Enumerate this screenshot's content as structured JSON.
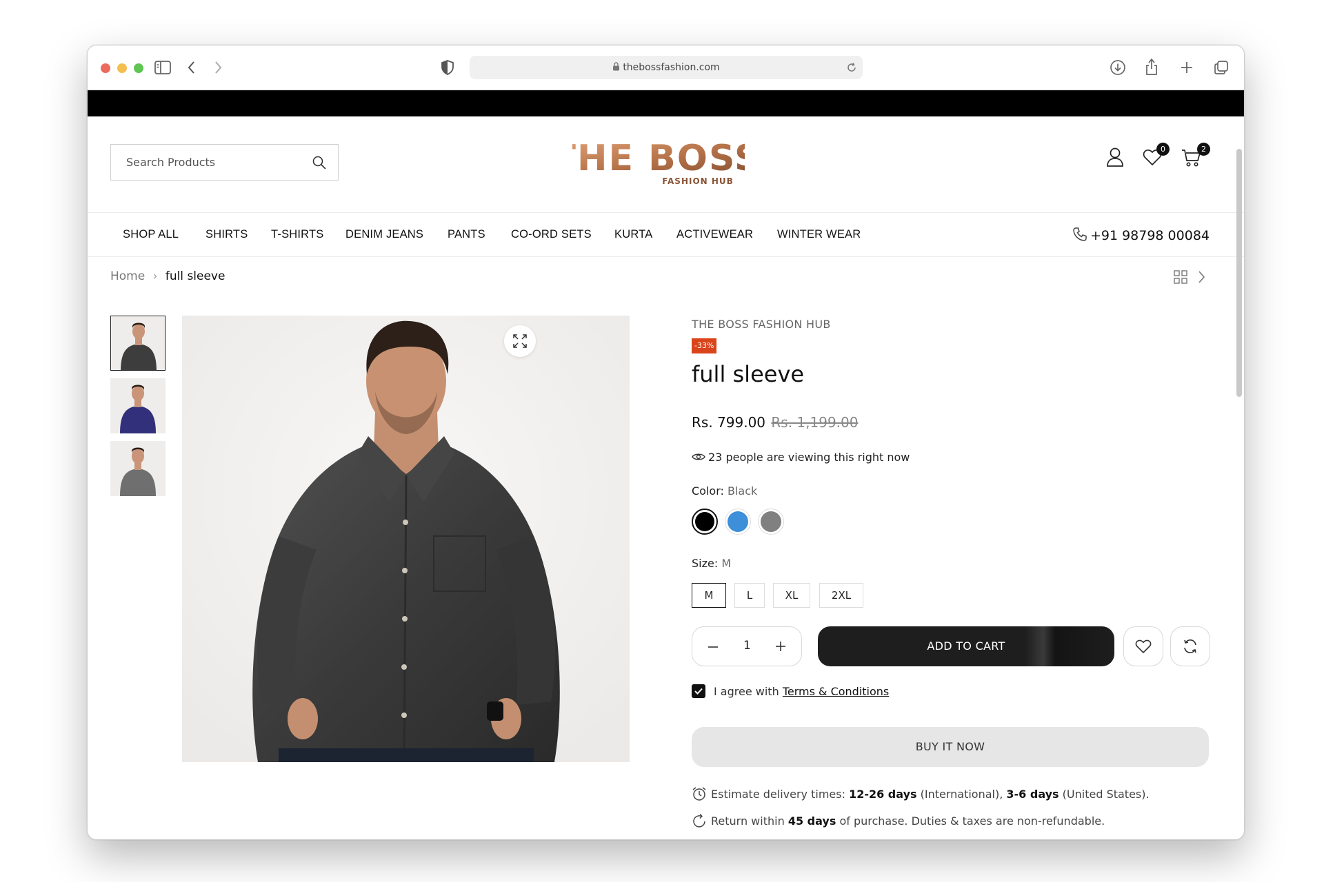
{
  "browser": {
    "url": "thebossfashion.com"
  },
  "header": {
    "search_placeholder": "Search Products",
    "logo_text": "THE BOSS",
    "logo_sub": "FASHION HUB",
    "wishlist_count": "0",
    "cart_count": "2"
  },
  "nav": {
    "items": [
      "SHOP ALL",
      "SHIRTS",
      "T-SHIRTS",
      "DENIM JEANS",
      "PANTS",
      "CO-ORD SETS",
      "KURTA",
      "ACTIVEWEAR",
      "WINTER WEAR"
    ],
    "phone": "+91 98798 00084"
  },
  "breadcrumb": {
    "home": "Home",
    "separator": "›",
    "current": "full sleeve"
  },
  "product": {
    "vendor": "THE BOSS FASHION HUB",
    "discount_badge": "-33%",
    "title": "full sleeve",
    "price": "Rs. 799.00",
    "compare_price": "Rs. 1,199.00",
    "viewers": "23 people are viewing this right now",
    "color_label": "Color:",
    "color_value": "Black",
    "colors": [
      {
        "name": "Black",
        "hex": "#000000",
        "selected": true
      },
      {
        "name": "Blue",
        "hex": "#3d8fd9",
        "selected": false
      },
      {
        "name": "Grey",
        "hex": "#808080",
        "selected": false
      }
    ],
    "size_label": "Size:",
    "size_value": "M",
    "sizes": [
      "M",
      "L",
      "XL",
      "2XL"
    ],
    "selected_size": "M",
    "quantity": "1",
    "add_to_cart": "ADD TO CART",
    "agree_text": "I agree with",
    "terms_link": "Terms & Conditions",
    "agree_checked": true,
    "buy_now": "BUY IT NOW",
    "delivery": {
      "prefix": "Estimate delivery times:",
      "intl_days": "12-26 days",
      "intl_label": "(International),",
      "us_days": "3-6 days",
      "us_label": "(United States)."
    },
    "return": {
      "prefix": "Return within",
      "days": "45 days",
      "suffix": "of purchase. Duties & taxes are non-refundable."
    }
  },
  "colors": {
    "badge": "#d9441a",
    "logo": "#b8744a",
    "dark_button": "#1e1e1e",
    "buy_now_bg": "#e6e6e6"
  }
}
